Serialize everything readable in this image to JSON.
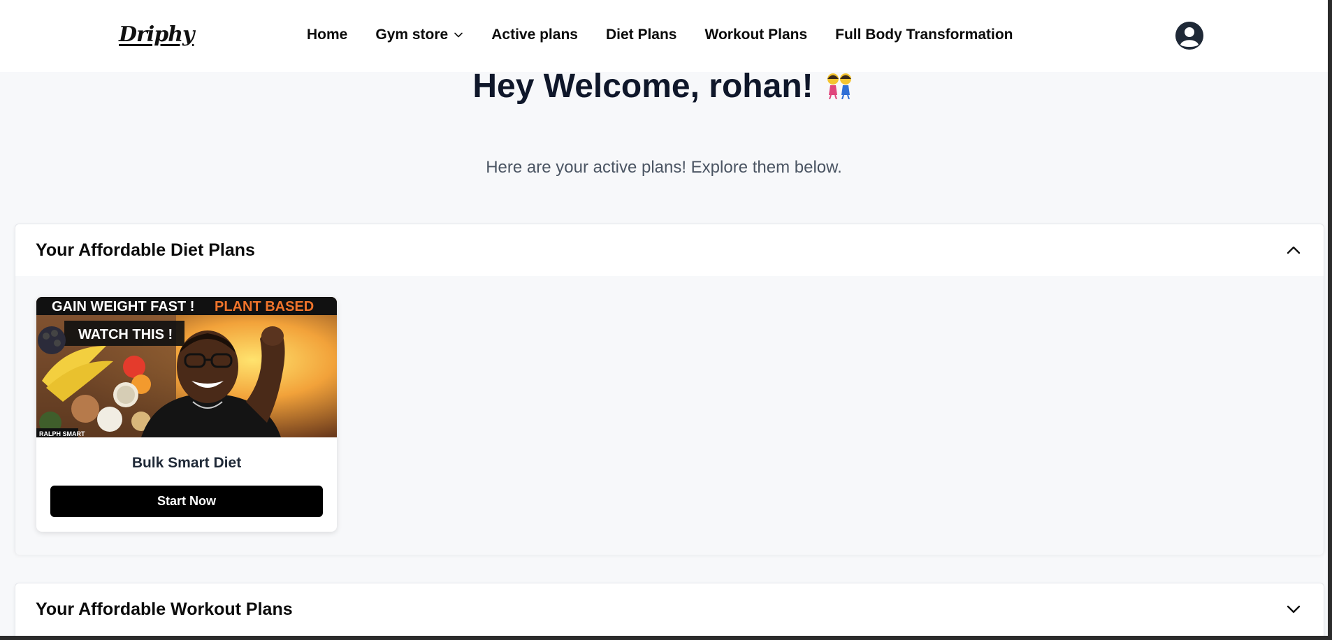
{
  "brand": {
    "logo_text": "Driphy"
  },
  "nav": {
    "items": [
      {
        "label": "Home"
      },
      {
        "label": "Gym store",
        "has_dropdown": true
      },
      {
        "label": "Active plans"
      },
      {
        "label": "Diet Plans"
      },
      {
        "label": "Workout Plans"
      },
      {
        "label": "Full Body Transformation"
      }
    ]
  },
  "user": {
    "avatar_icon": "user-circle-icon"
  },
  "welcome": {
    "heading": "Hey Welcome, rohan!",
    "emoji_icon": "dancers-emoji",
    "subtitle": "Here are your active plans! Explore them below."
  },
  "sections": {
    "diet": {
      "title": "Your Affordable Diet Plans",
      "expanded": true,
      "cards": [
        {
          "name": "Bulk Smart Diet",
          "button_label": "Start Now",
          "thumbnail_texts": [
            "GAIN WEIGHT FAST !",
            "PLANT BASED",
            "WATCH THIS !",
            "RALPH SMART"
          ]
        }
      ]
    },
    "workout": {
      "title": "Your Affordable Workout Plans",
      "expanded": false
    }
  },
  "colors": {
    "page_bg": "#f7f8fa",
    "header_bg": "#ffffff",
    "button_bg": "#000000",
    "heading": "#0f172a",
    "thumb_orange": "#f0742b"
  }
}
